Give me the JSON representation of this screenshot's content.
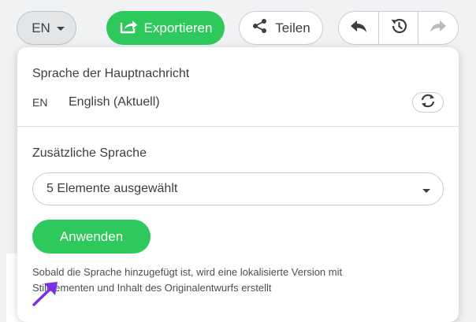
{
  "toolbar": {
    "language_button": {
      "label": "EN",
      "icon": "chevron-down-icon"
    },
    "export_button": {
      "label": "Exportieren",
      "icon": "export-icon",
      "color": "#2ec95c"
    },
    "share_button": {
      "label": "Teilen",
      "icon": "share-icon"
    },
    "history": {
      "undo_icon": "undo-icon",
      "history_icon": "history-icon",
      "redo_icon": "redo-icon"
    }
  },
  "language_panel": {
    "main_language_title": "Sprache der Hauptnachricht",
    "main_language": {
      "code": "EN",
      "name": "English (Aktuell)",
      "action_icon": "refresh-icon"
    },
    "additional_language_title": "Zusätzliche Sprache",
    "additional_select": {
      "value": "5 Elemente ausgewählt",
      "icon": "chevron-down-icon"
    },
    "apply_button": {
      "label": "Anwenden",
      "color": "#2ec95c"
    },
    "note": "Sobald die Sprache hinzugefügt ist, wird eine lokalisierte Version mit Stilelementen und Inhalt des Originalentwurfs erstellt"
  },
  "annotation": {
    "icon": "pointer-arrow-icon",
    "color": "#7a2fe0"
  }
}
